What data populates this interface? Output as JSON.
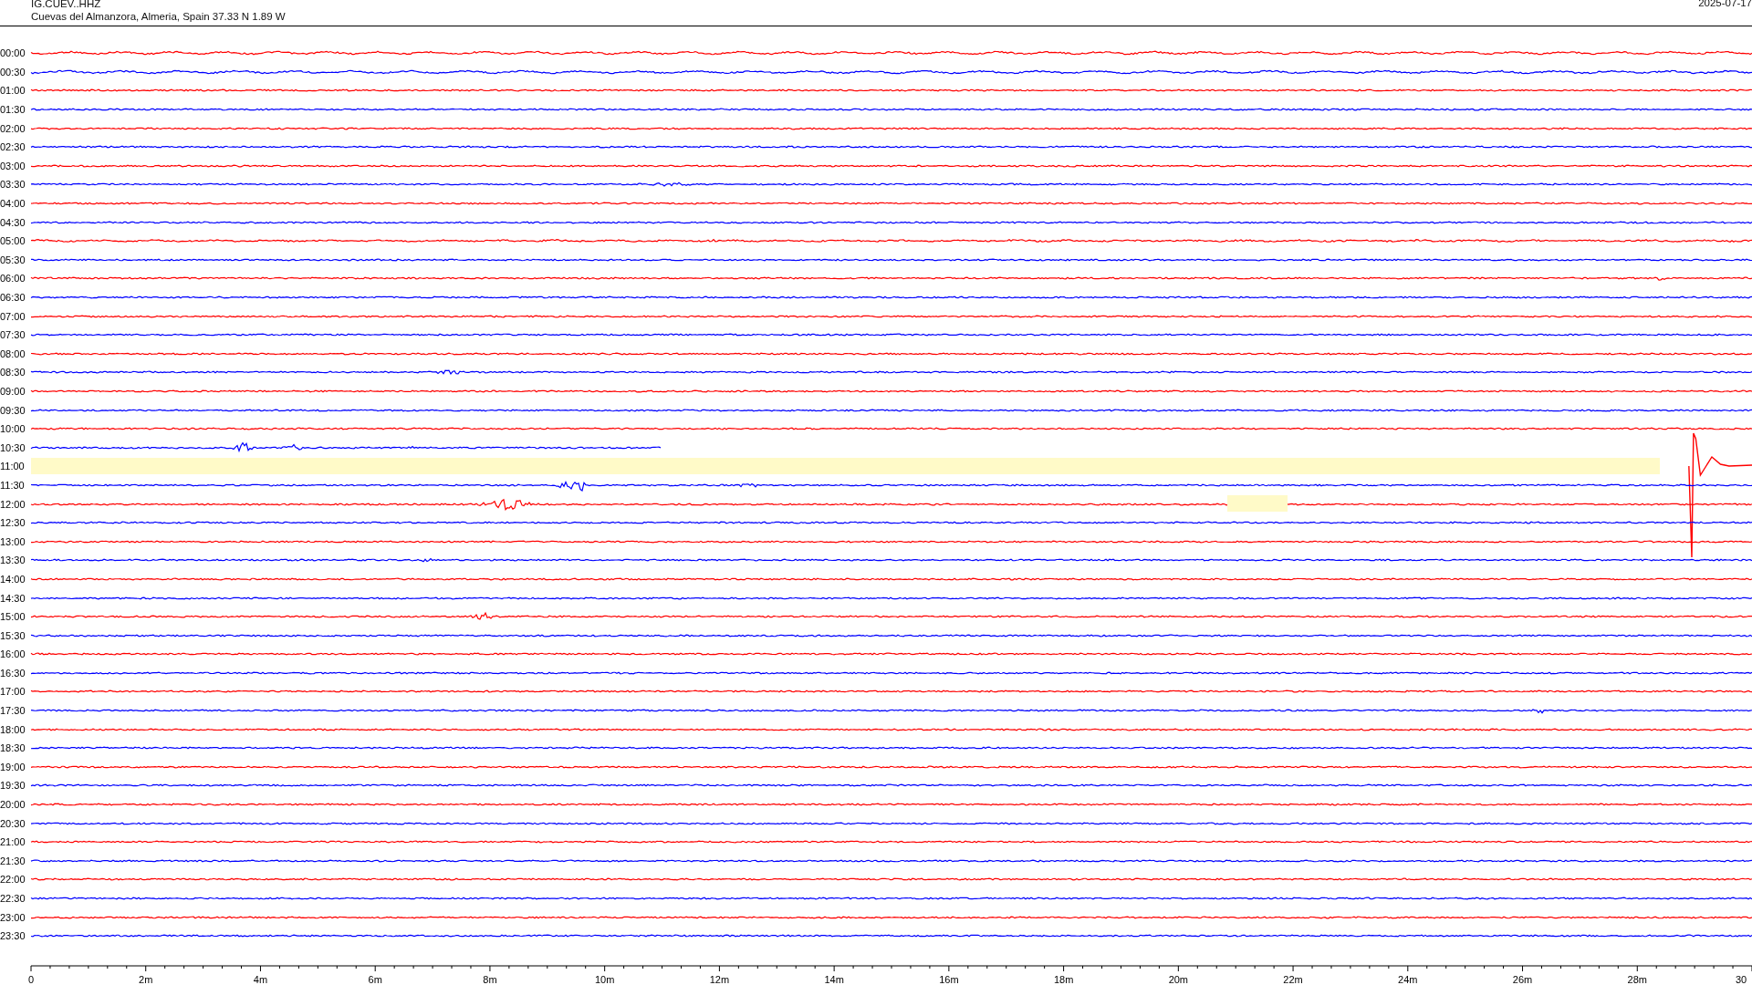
{
  "header": {
    "station": "IG.CUEV..HHZ",
    "location": "Cuevas del Almanzora, Almeria, Spain  37.33 N 1.89 W",
    "date": "2025-07-17"
  },
  "rows": [
    {
      "time": "00:00",
      "color": "#ff0000"
    },
    {
      "time": "00:30",
      "color": "#0000ff"
    },
    {
      "time": "01:00",
      "color": "#ff0000"
    },
    {
      "time": "01:30",
      "color": "#0000ff"
    },
    {
      "time": "02:00",
      "color": "#ff0000"
    },
    {
      "time": "02:30",
      "color": "#0000ff"
    },
    {
      "time": "03:00",
      "color": "#ff0000"
    },
    {
      "time": "03:30",
      "color": "#0000ff"
    },
    {
      "time": "04:00",
      "color": "#ff0000"
    },
    {
      "time": "04:30",
      "color": "#0000ff"
    },
    {
      "time": "05:00",
      "color": "#ff0000"
    },
    {
      "time": "05:30",
      "color": "#0000ff"
    },
    {
      "time": "06:00",
      "color": "#ff0000"
    },
    {
      "time": "06:30",
      "color": "#0000ff"
    },
    {
      "time": "07:00",
      "color": "#ff0000"
    },
    {
      "time": "07:30",
      "color": "#0000ff"
    },
    {
      "time": "08:00",
      "color": "#ff0000"
    },
    {
      "time": "08:30",
      "color": "#0000ff"
    },
    {
      "time": "09:00",
      "color": "#ff0000"
    },
    {
      "time": "09:30",
      "color": "#0000ff"
    },
    {
      "time": "10:00",
      "color": "#ff0000"
    },
    {
      "time": "10:30",
      "color": "#0000ff"
    },
    {
      "time": "11:00",
      "color": "#ff0000"
    },
    {
      "time": "11:30",
      "color": "#0000ff"
    },
    {
      "time": "12:00",
      "color": "#ff0000"
    },
    {
      "time": "12:30",
      "color": "#0000ff"
    },
    {
      "time": "13:00",
      "color": "#ff0000"
    },
    {
      "time": "13:30",
      "color": "#0000ff"
    },
    {
      "time": "14:00",
      "color": "#ff0000"
    },
    {
      "time": "14:30",
      "color": "#0000ff"
    },
    {
      "time": "15:00",
      "color": "#ff0000"
    },
    {
      "time": "15:30",
      "color": "#0000ff"
    },
    {
      "time": "16:00",
      "color": "#ff0000"
    },
    {
      "time": "16:30",
      "color": "#0000ff"
    },
    {
      "time": "17:00",
      "color": "#ff0000"
    },
    {
      "time": "17:30",
      "color": "#0000ff"
    },
    {
      "time": "18:00",
      "color": "#ff0000"
    },
    {
      "time": "18:30",
      "color": "#0000ff"
    },
    {
      "time": "19:00",
      "color": "#ff0000"
    },
    {
      "time": "19:30",
      "color": "#0000ff"
    },
    {
      "time": "20:00",
      "color": "#ff0000"
    },
    {
      "time": "20:30",
      "color": "#0000ff"
    },
    {
      "time": "21:00",
      "color": "#ff0000"
    },
    {
      "time": "21:30",
      "color": "#0000ff"
    },
    {
      "time": "22:00",
      "color": "#ff0000"
    },
    {
      "time": "22:30",
      "color": "#0000ff"
    },
    {
      "time": "23:00",
      "color": "#ff0000"
    },
    {
      "time": "23:30",
      "color": "#0000ff"
    }
  ],
  "time_axis": {
    "labels": [
      "0",
      "2m",
      "4m",
      "6m",
      "8m",
      "10m",
      "12m",
      "14m",
      "16m",
      "18m",
      "20m",
      "22m",
      "24m",
      "26m",
      "28m",
      "30"
    ]
  }
}
